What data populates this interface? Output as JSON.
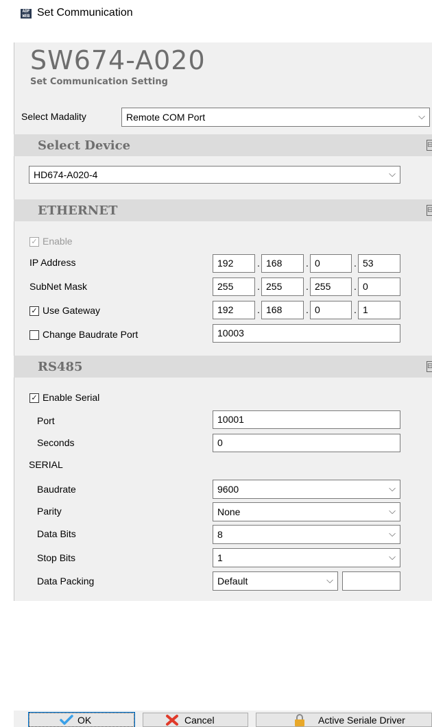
{
  "window": {
    "title": "Set Communication",
    "icon_text": "ADF WEB"
  },
  "header": {
    "product": "SW674-A020",
    "subtitle": "Set Communication Setting"
  },
  "modality": {
    "label": "Select Madality",
    "value": "Remote COM Port"
  },
  "select_device": {
    "title": "Select Device",
    "value": "HD674-A020-4"
  },
  "ethernet": {
    "title": "ETHERNET",
    "enable_label": "Enable",
    "ip_label": "IP Address",
    "ip": [
      "192",
      "168",
      "0",
      "53"
    ],
    "subnet_label": "SubNet Mask",
    "subnet": [
      "255",
      "255",
      "255",
      "0"
    ],
    "gateway_label": "Use Gateway",
    "gateway": [
      "192",
      "168",
      "0",
      "1"
    ],
    "baudrate_port_label": "Change Baudrate Port",
    "baudrate_port": "10003"
  },
  "rs485": {
    "title": "RS485",
    "enable_serial_label": "Enable Serial",
    "port_label": "Port",
    "port": "10001",
    "seconds_label": "Seconds",
    "seconds": "0",
    "serial_label": "SERIAL",
    "baudrate_label": "Baudrate",
    "baudrate": "9600",
    "parity_label": "Parity",
    "parity": "None",
    "databits_label": "Data Bits",
    "databits": "8",
    "stopbits_label": "Stop Bits",
    "stopbits": "1",
    "datapacking_label": "Data Packing",
    "datapacking": "Default",
    "datapacking_extra": ""
  },
  "buttons": {
    "ok": "OK",
    "cancel": "Cancel",
    "active_driver": "Active Seriale Driver"
  },
  "colors": {
    "section_bg": "#dcdcdc",
    "title_gray": "#6e6e6e",
    "ok_check": "#3aa0e8",
    "cancel_x": "#e03a2a",
    "lock": "#e8a82a"
  }
}
